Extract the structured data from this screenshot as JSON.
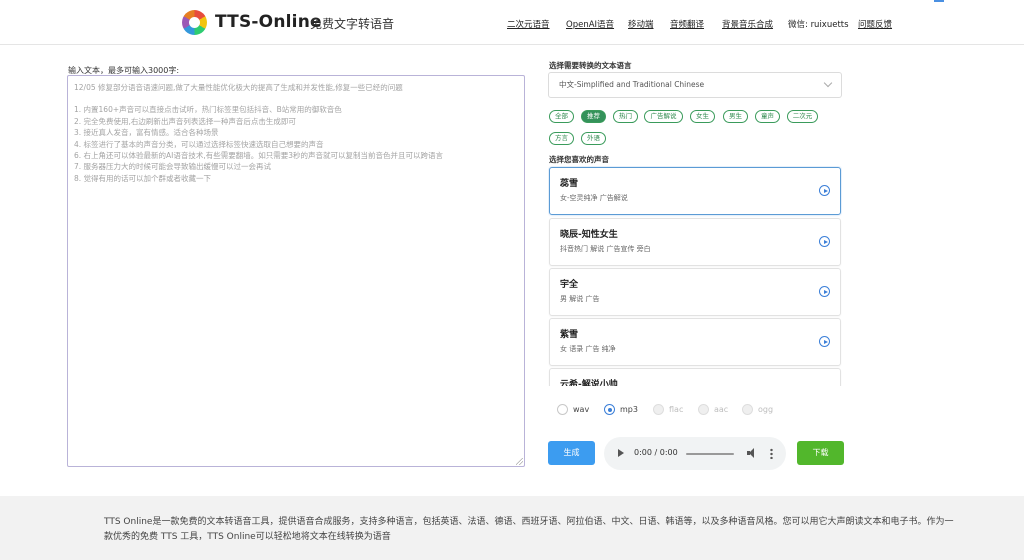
{
  "header": {
    "brand": "TTS-Online",
    "brand_sub": "免费文字转语音",
    "nav": [
      {
        "label": "二次元语音"
      },
      {
        "label": "OpenAI语音"
      },
      {
        "label": "移动端"
      },
      {
        "label": "音频翻译"
      },
      {
        "label": "背景音乐合成"
      },
      {
        "label": "微信: ruixuetts"
      },
      {
        "label": "问题反馈"
      }
    ]
  },
  "input": {
    "label": "输入文本，最多可输入3000字:",
    "lines": [
      "12/05 修复部分语音语速问题,做了大量性能优化极大的提高了生成和并发性能,修复一些已经的问题",
      "1. 内置160+声音可以直接点击试听，热门标签里包括抖音、B站常用的御软音色",
      "2. 完全免费使用,右边刷新出声音列表选择一种声音后点击生成即可",
      "3. 接近真人发音，富有情感。适合各种场景",
      "4. 标签进行了基本的声音分类，可以通过选择标签快速选取自己想要的声音",
      "6. 右上角还可以体验最新的AI语音技术,有些需要翻墙。如只需要3秒的声音就可以复制当前音色并且可以跨语言",
      "7. 服务器压力大的时候可能会导致输出缓慢可以过一会再试",
      "8. 觉得有用的话可以加个群或者收藏一下"
    ]
  },
  "language": {
    "label": "选择需要转换的文本语言",
    "selected": "中文-Simplified and Traditional Chinese"
  },
  "tags": [
    {
      "label": "全部",
      "active": false
    },
    {
      "label": "推荐",
      "active": true
    },
    {
      "label": "热门",
      "active": false
    },
    {
      "label": "广告解说",
      "active": false
    },
    {
      "label": "女生",
      "active": false
    },
    {
      "label": "男生",
      "active": false
    },
    {
      "label": "童声",
      "active": false
    },
    {
      "label": "二次元",
      "active": false
    },
    {
      "label": "方言",
      "active": false
    },
    {
      "label": "外语",
      "active": false
    }
  ],
  "voices": {
    "label": "选择您喜欢的声音",
    "items": [
      {
        "name": "蕊雪",
        "desc": "女-空灵纯净 广告解说",
        "selected": true
      },
      {
        "name": "晓辰-知性女生",
        "desc": "抖音热门 解说 广告宣传 旁白",
        "selected": false
      },
      {
        "name": "宇全",
        "desc": "男 解说 广告",
        "selected": false
      },
      {
        "name": "紫雪",
        "desc": "女 语录 广告 纯净",
        "selected": false
      },
      {
        "name": "云希-解说小帅",
        "desc": "",
        "selected": false
      }
    ]
  },
  "formats": [
    {
      "label": "wav",
      "checked": false,
      "disabled": false
    },
    {
      "label": "mp3",
      "checked": true,
      "disabled": false
    },
    {
      "label": "flac",
      "checked": false,
      "disabled": true
    },
    {
      "label": "aac",
      "checked": false,
      "disabled": true
    },
    {
      "label": "ogg",
      "checked": false,
      "disabled": true
    }
  ],
  "actions": {
    "generate": "生成",
    "download": "下载",
    "audio_time": "0:00 / 0:00"
  },
  "footer": {
    "text": "TTS Online是一款免费的文本转语音工具，提供语音合成服务，支持多种语言，包括英语、法语、德语、西班牙语、阿拉伯语、中文、日语、韩语等，以及多种语音风格。您可以用它大声朗读文本和电子书。作为一款优秀的免费 TTS 工具，TTS Online可以轻松地将文本在线转换为语音"
  },
  "colors": {
    "accent_green": "#34925a",
    "generate_blue": "#3c9cf0",
    "download_green": "#52b72c",
    "selected_border": "#5b9bd5"
  }
}
